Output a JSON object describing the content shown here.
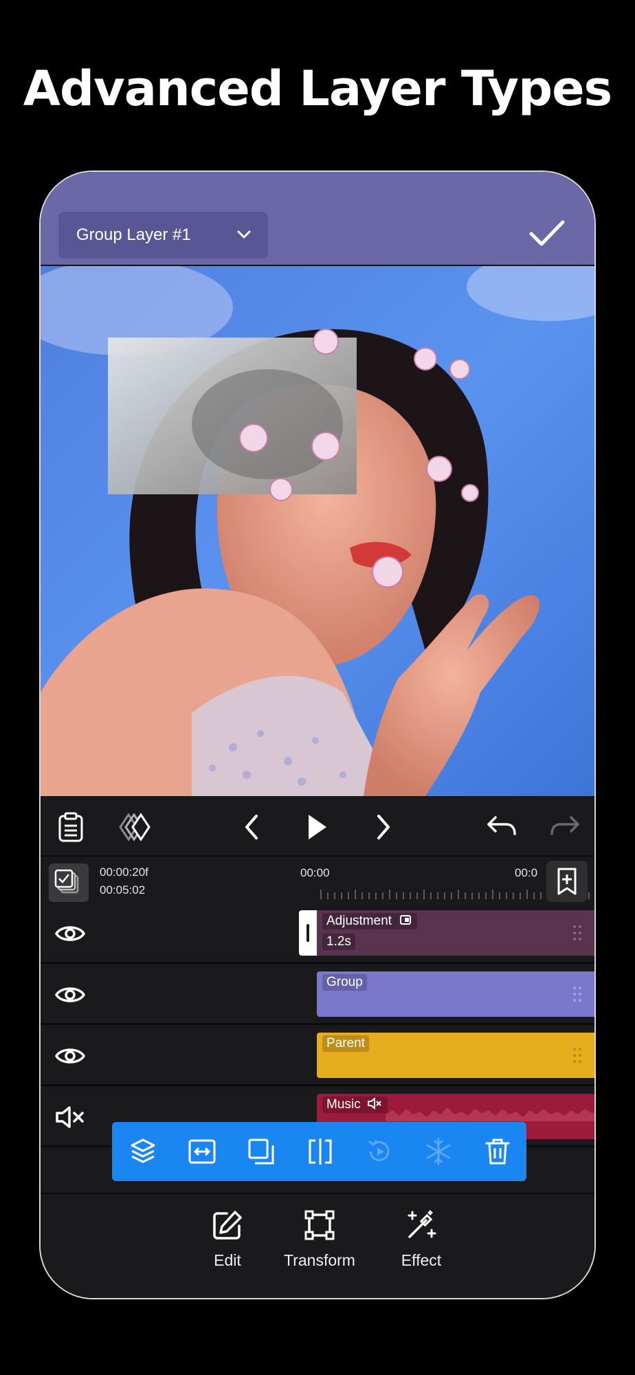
{
  "headline": "Advanced Layer Types",
  "topbar": {
    "layer_selector": "Group Layer #1",
    "confirm_icon": "checkmark-icon"
  },
  "playback": {
    "icons": [
      "clipboard-icon",
      "keyframe-icon",
      "previous-icon",
      "play-icon",
      "next-icon",
      "undo-icon",
      "redo-icon"
    ]
  },
  "timeline": {
    "current_time": "00:00:20f",
    "total_time": "00:05:02",
    "ruler_start": "00:00",
    "ruler_next": "00:0"
  },
  "tracks": [
    {
      "name": "Adjustment",
      "duration": "1.2s",
      "color": "#5a3350",
      "visibility_icon": "eye-icon"
    },
    {
      "name": "Group",
      "color": "#7a77cc",
      "visibility_icon": "eye-icon"
    },
    {
      "name": "Parent",
      "color": "#e6ad1f",
      "visibility_icon": "eye-icon"
    },
    {
      "name": "Music",
      "color": "#9c1a3c",
      "visibility_icon": "mute-icon"
    }
  ],
  "floating_toolbar": {
    "icons": [
      "layer-stack-icon",
      "fit-width-icon",
      "duplicate-icon",
      "split-icon",
      "reset-icon",
      "freeze-icon",
      "trash-icon"
    ],
    "color": "#1a86f2"
  },
  "tools": [
    {
      "label": "Edit",
      "icon": "edit-icon"
    },
    {
      "label": "Transform",
      "icon": "transform-icon"
    },
    {
      "label": "Effect",
      "icon": "effect-wand-icon"
    }
  ]
}
